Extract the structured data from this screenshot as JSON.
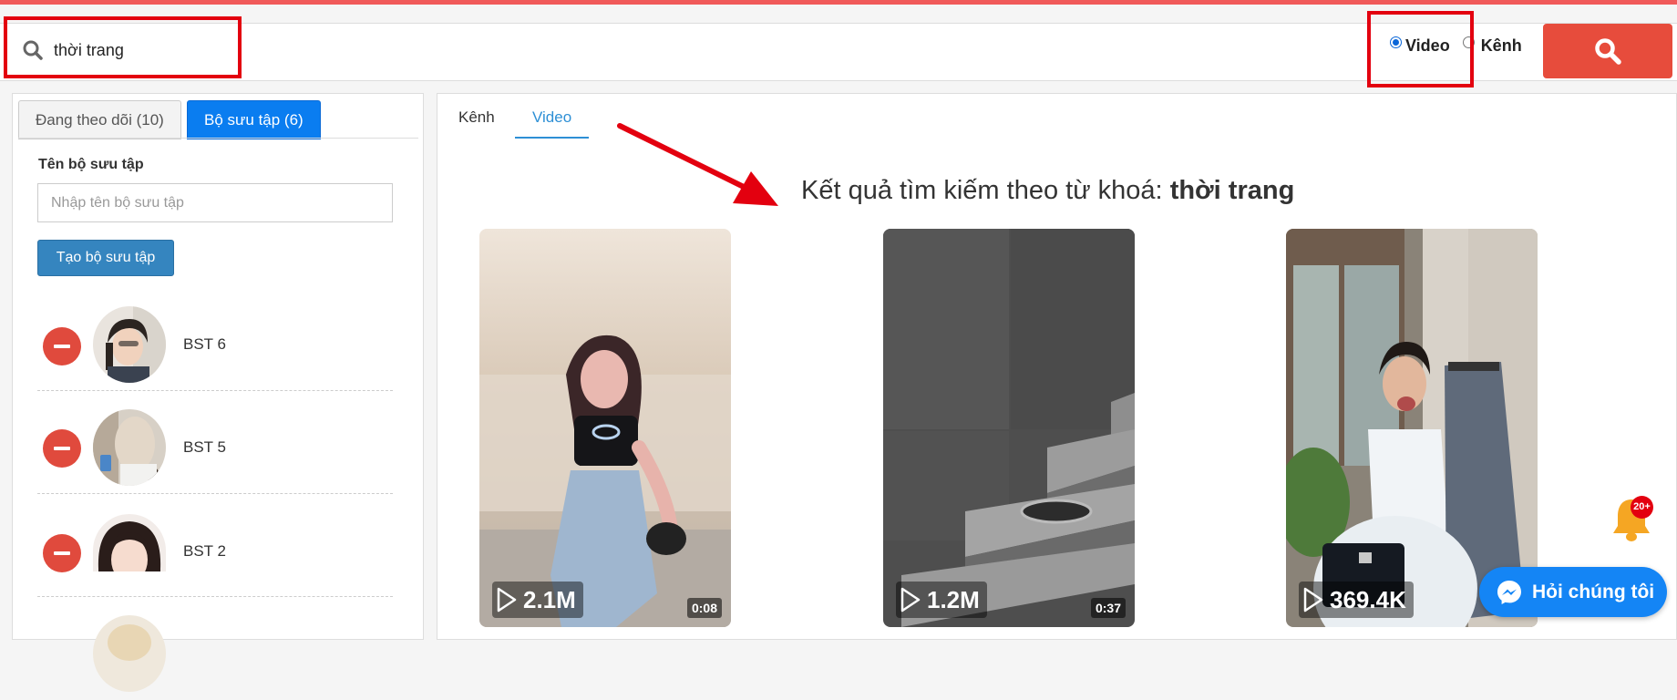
{
  "search": {
    "query": "thời trang"
  },
  "search_type": {
    "options": [
      "Video",
      "Kênh"
    ],
    "selected": "Video"
  },
  "left_panel": {
    "tabs": [
      {
        "label": "Đang theo dõi (10)",
        "active": false
      },
      {
        "label": "Bộ sưu tập (6)",
        "active": true
      }
    ],
    "collection_name_label": "Tên bộ sưu tập",
    "collection_name_placeholder": "Nhập tên bộ sưu tập",
    "create_button": "Tạo bộ sưu tập",
    "collections": [
      {
        "name": "BST 6"
      },
      {
        "name": "BST 5"
      },
      {
        "name": "BST 2"
      }
    ]
  },
  "right_panel": {
    "tabs": [
      {
        "label": "Kênh",
        "active": false
      },
      {
        "label": "Video",
        "active": true
      }
    ],
    "heading_prefix": "Kết quả tìm kiếm theo từ khoá:",
    "heading_keyword": "thời trang",
    "videos": [
      {
        "views": "2.1M",
        "duration": "0:08"
      },
      {
        "views": "1.2M",
        "duration": "0:37"
      },
      {
        "views": "369.4K",
        "duration": ""
      }
    ]
  },
  "notifications": {
    "badge": "20+"
  },
  "chat": {
    "label": "Hỏi chúng tôi"
  },
  "colors": {
    "brand_red": "#e74c3c",
    "active_tab_blue": "#0a7df0",
    "highlight_red": "#e3000f",
    "chat_blue": "#1485f5"
  }
}
